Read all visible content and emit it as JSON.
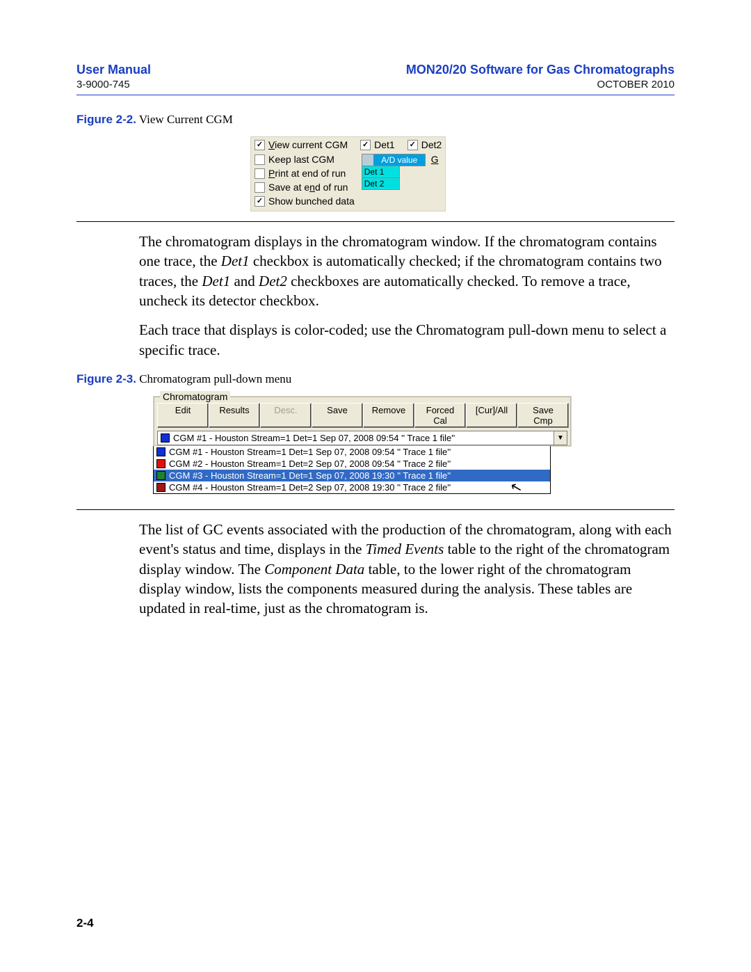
{
  "header": {
    "left_title": "User Manual",
    "left_sub": "3-9000-745",
    "right_title": "MON20/20 Software for Gas Chromatographs",
    "right_sub": "OCTOBER 2010"
  },
  "fig1": {
    "caption_num": "Figure 2-2.",
    "caption_text": "  View Current CGM",
    "view_current": "View current CGM",
    "det1": "Det1",
    "det2": "Det2",
    "keep_last": "Keep last CGM",
    "print_end": "Print at end of run",
    "save_end": "Save at end of run",
    "show_bunched": "Show bunched data",
    "ad_value": "A/D value",
    "det1_cell": "Det 1",
    "det2_cell": "Det 2",
    "g": "G"
  },
  "para1_a": "The chromatogram displays in the chromatogram window.  If the chromatogram contains one trace, the ",
  "para1_b": "Det1",
  "para1_c": " checkbox is automatically checked; if the chromatogram contains two traces, the ",
  "para1_d": "Det1",
  "para1_e": " and ",
  "para1_f": "Det2",
  "para1_g": " checkboxes are automatically checked.  To remove a trace, uncheck its detector checkbox.",
  "para2": "Each trace that displays is color-coded; use the Chromatogram pull-down menu to select a specific trace.",
  "fig2": {
    "caption_num": "Figure 2-3.",
    "caption_text": "  Chromatogram pull-down menu",
    "group_label": "Chromatogram",
    "buttons": [
      "Edit",
      "Results",
      "Desc.",
      "Save",
      "Remove",
      "Forced Cal",
      "[Cur]/All",
      "Save Cmp"
    ],
    "selected": "CGM #1 - Houston Stream=1 Det=1 Sep 07, 2008 09:54 '' Trace 1 file''",
    "items": [
      {
        "color": "#1030d8",
        "text": "CGM #1 - Houston Stream=1 Det=1 Sep 07, 2008 09:54 '' Trace 1 file''"
      },
      {
        "color": "#e01010",
        "text": "CGM #2 - Houston Stream=1 Det=2 Sep 07, 2008 09:54 '' Trace 2 file''"
      },
      {
        "color": "#208030",
        "text": "CGM #3 - Houston Stream=1 Det=1 Sep 07, 2008 19:30 '' Trace 1 file''"
      },
      {
        "color": "#a01818",
        "text": "CGM #4 - Houston Stream=1 Det=2 Sep 07, 2008 19:30 '' Trace 2 file''"
      }
    ]
  },
  "para3_a": "The list of GC events associated with the production of the chromatogram, along with each event's status and time, displays in the ",
  "para3_b": "Timed Events",
  "para3_c": " table to the right of the chromatogram display window.  The ",
  "para3_d": "Component Data",
  "para3_e": " table, to the lower right of the chromatogram display window, lists the components measured during the analysis.  These tables are updated in real-time, just as the chromatogram is.",
  "pagenum": "2-4"
}
